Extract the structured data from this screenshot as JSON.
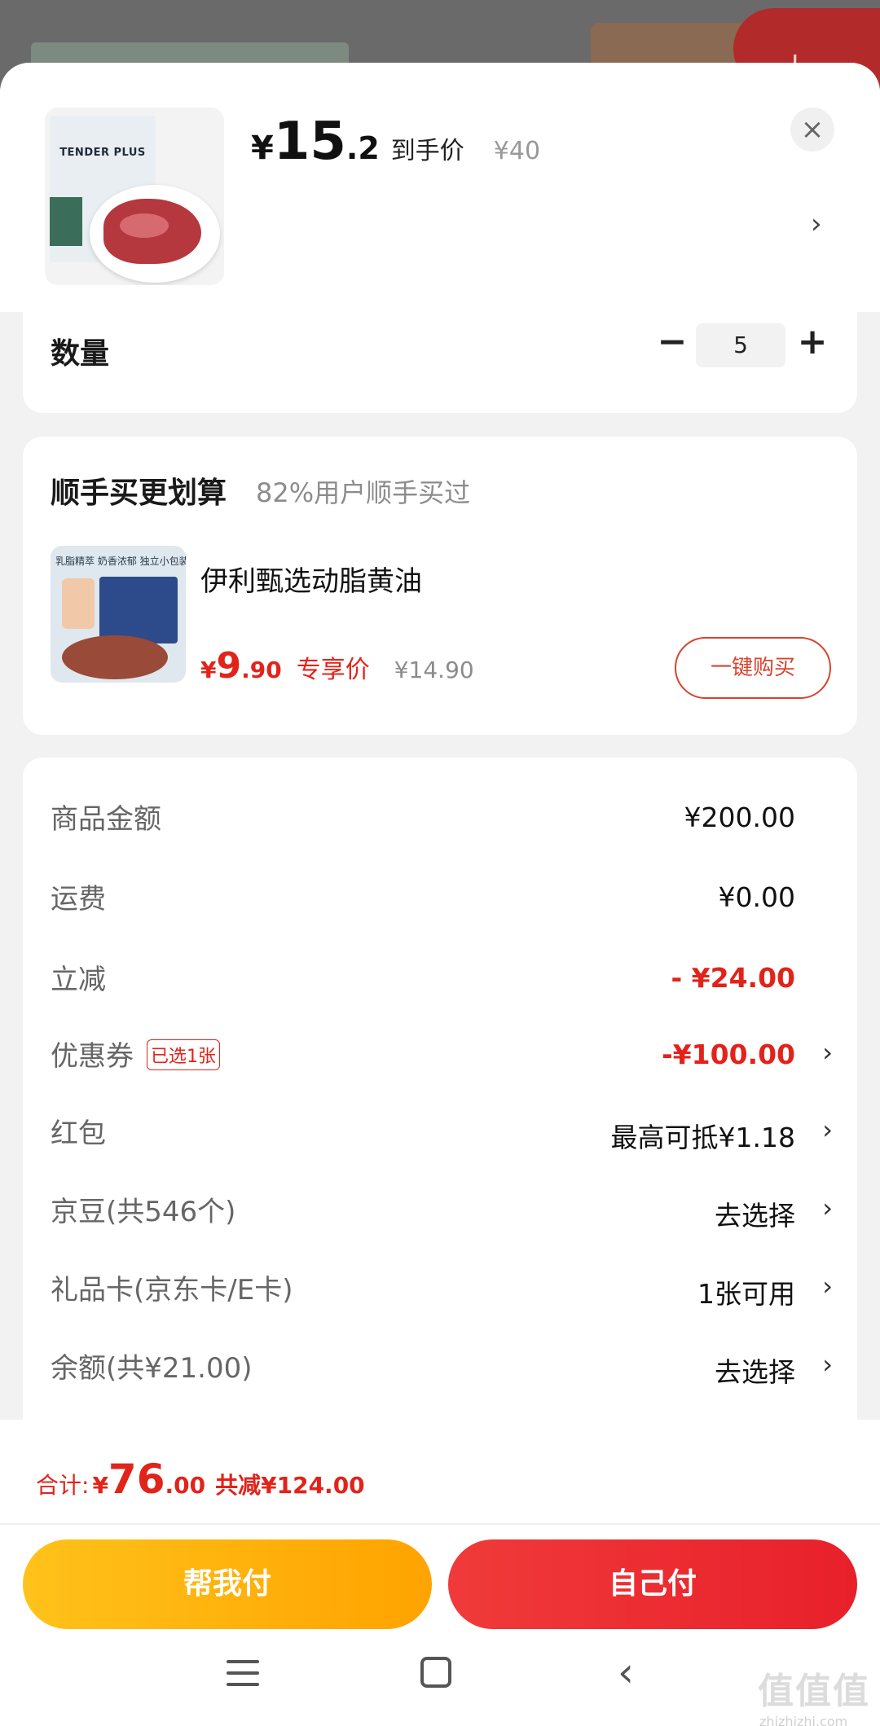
{
  "background": {
    "badge_text": "九"
  },
  "product": {
    "image_name": "TENDER PLUS steak pack",
    "brand": "TENDER PLUS",
    "currency": "¥",
    "price_int": "15",
    "price_dec": ".2",
    "price_tag": "到手价",
    "orig_price": "¥40",
    "close_icon": "×",
    "chevron": "›"
  },
  "quantity": {
    "label": "数量",
    "minus": "−",
    "value": "5",
    "plus": "+"
  },
  "upsell": {
    "title": "顺手买更划算",
    "subtitle": "82%用户顺手买过",
    "image_caption": "乳脂精萃 奶香浓郁 独立小包装",
    "name": "伊利甄选动脂黄油",
    "currency": "¥",
    "price_int": "9",
    "price_dec": ".90",
    "price_tag": "专享价",
    "orig_price": "¥14.90",
    "buy_label": "一键购买"
  },
  "summary": {
    "rows": [
      {
        "label": "商品金额",
        "value": "¥200.00"
      },
      {
        "label": "运费",
        "value": "¥0.00"
      },
      {
        "label": "立减",
        "value": "- ¥24.00"
      },
      {
        "label": "优惠券",
        "tag": "已选1张",
        "value": "-¥100.00",
        "chevron": "›"
      },
      {
        "label": "红包",
        "value": "最高可抵¥1.18",
        "chevron": "›"
      },
      {
        "label": "京豆(共546个)",
        "value": "去选择",
        "chevron": "›"
      },
      {
        "label": "礼品卡(京东卡/E卡)",
        "value": "1张可用",
        "chevron": "›"
      },
      {
        "label": "余额(共¥21.00)",
        "value": "去选择",
        "chevron": "›"
      }
    ]
  },
  "footer": {
    "total_label": "合计:",
    "currency": "¥",
    "total_int": "76",
    "total_dec": ".00",
    "saved": "共减¥124.00",
    "help_pay": "帮我付",
    "self_pay": "自己付"
  },
  "nav": {
    "back": "‹"
  },
  "watermark": {
    "main": "值值值",
    "sub": "zhizhizhi.com"
  },
  "colors": {
    "accent_red": "#e2231a",
    "help_btn": "#ffb300",
    "self_btn": "#ee2c33"
  }
}
